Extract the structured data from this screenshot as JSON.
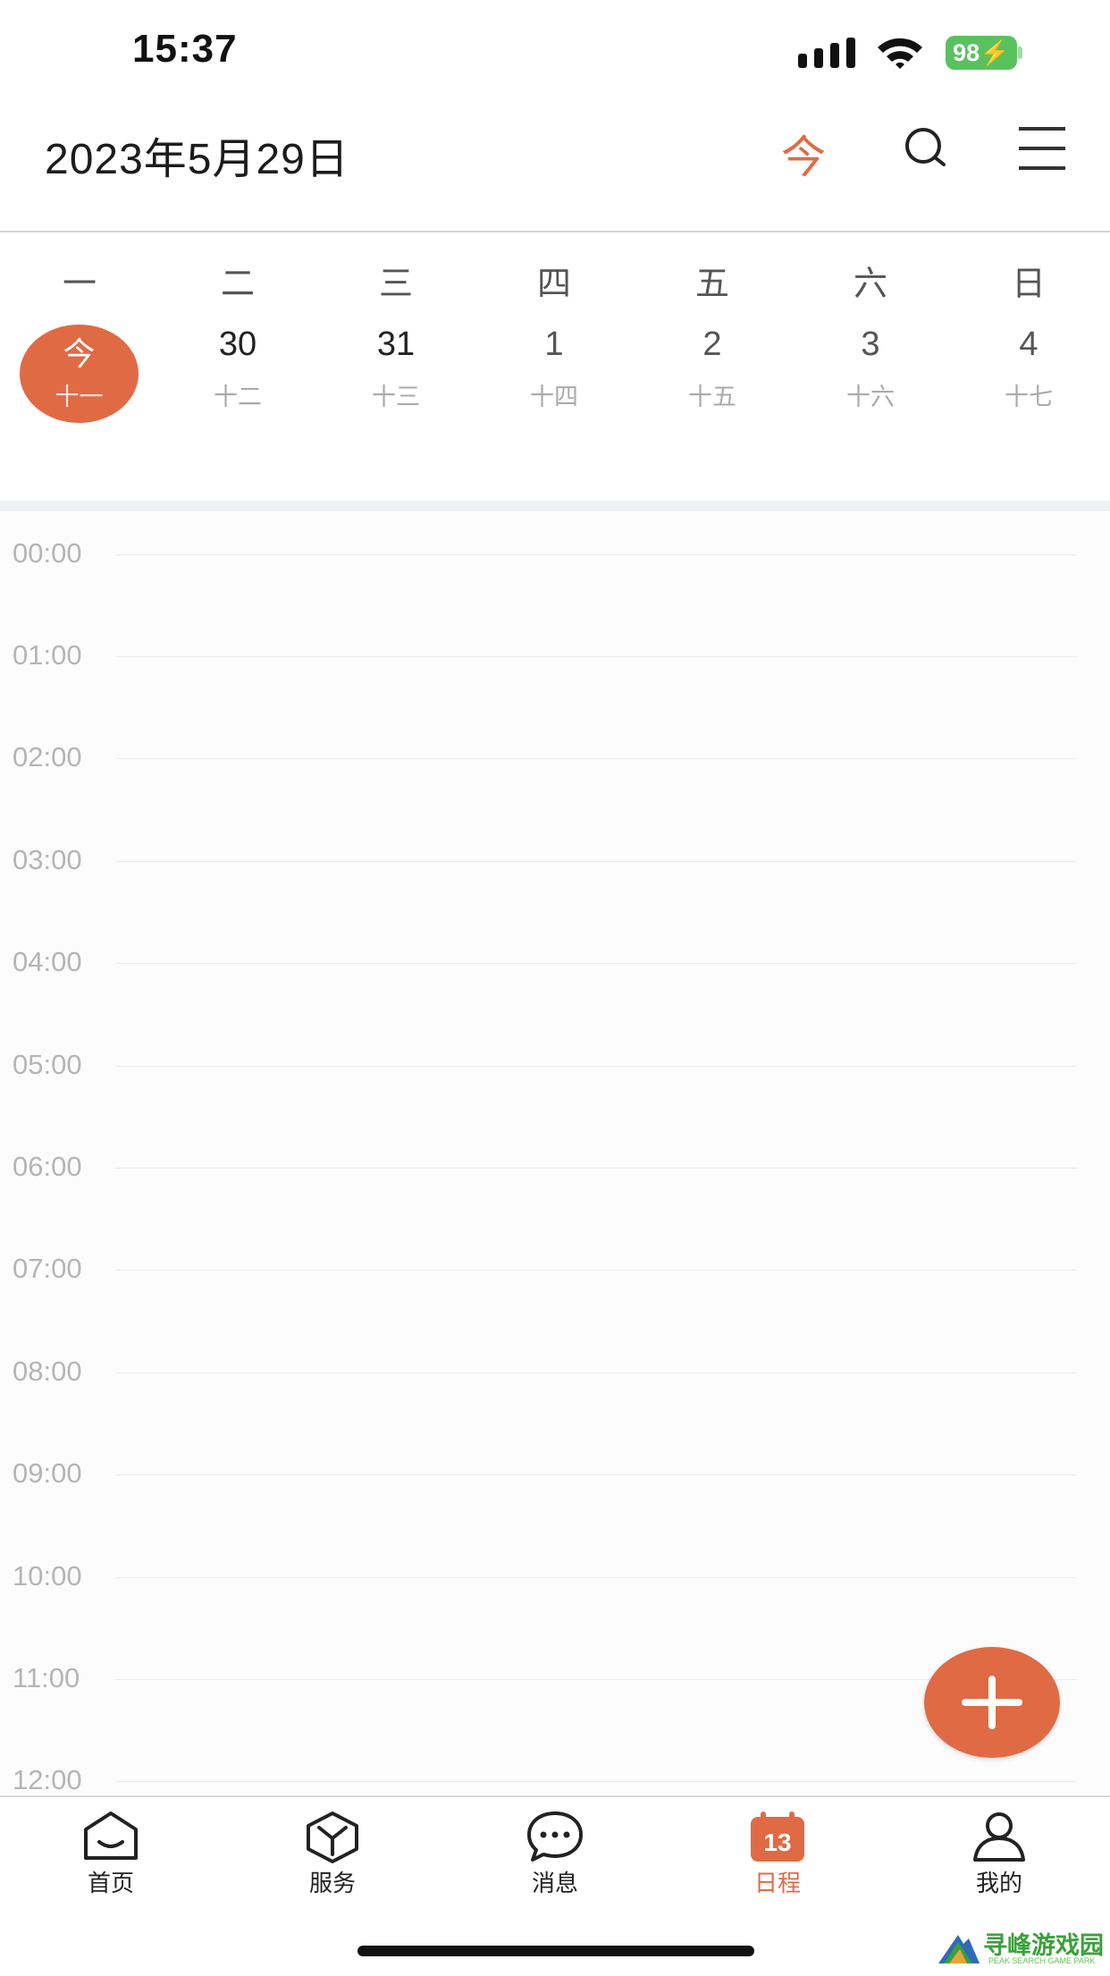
{
  "status_bar": {
    "time": "15:37",
    "battery": "98",
    "icons": [
      "signal-icon",
      "wifi-icon",
      "battery-charging-icon"
    ]
  },
  "header": {
    "date": "2023年5月29日",
    "today_label": "今",
    "icons": [
      "search-icon",
      "menu-icon"
    ]
  },
  "week": {
    "weekdays": [
      "一",
      "二",
      "三",
      "四",
      "五",
      "六",
      "日"
    ],
    "days": [
      {
        "day": "今",
        "lunar": "十一",
        "today": true
      },
      {
        "day": "30",
        "lunar": "十二"
      },
      {
        "day": "31",
        "lunar": "十三"
      },
      {
        "day": "1",
        "lunar": "十四"
      },
      {
        "day": "2",
        "lunar": "十五"
      },
      {
        "day": "3",
        "lunar": "十六"
      },
      {
        "day": "4",
        "lunar": "十七"
      }
    ]
  },
  "timeline": {
    "hours": [
      "00:00",
      "01:00",
      "02:00",
      "03:00",
      "04:00",
      "05:00",
      "06:00",
      "07:00",
      "08:00",
      "09:00",
      "10:00",
      "11:00",
      "12:00"
    ]
  },
  "fab": {
    "icon": "plus-icon"
  },
  "tabs": [
    {
      "label": "首页",
      "icon": "home-icon"
    },
    {
      "label": "服务",
      "icon": "cube-icon"
    },
    {
      "label": "消息",
      "icon": "chat-bubble-icon"
    },
    {
      "label": "日程",
      "icon": "calendar-icon",
      "active": true,
      "badge": "13"
    },
    {
      "label": "我的",
      "icon": "profile-icon"
    }
  ],
  "watermark": {
    "text": "寻峰游戏园",
    "sub": "PEAK SEARCH GAME PARK"
  },
  "colors": {
    "accent": "#e06a44",
    "battery": "#5ac15f"
  }
}
